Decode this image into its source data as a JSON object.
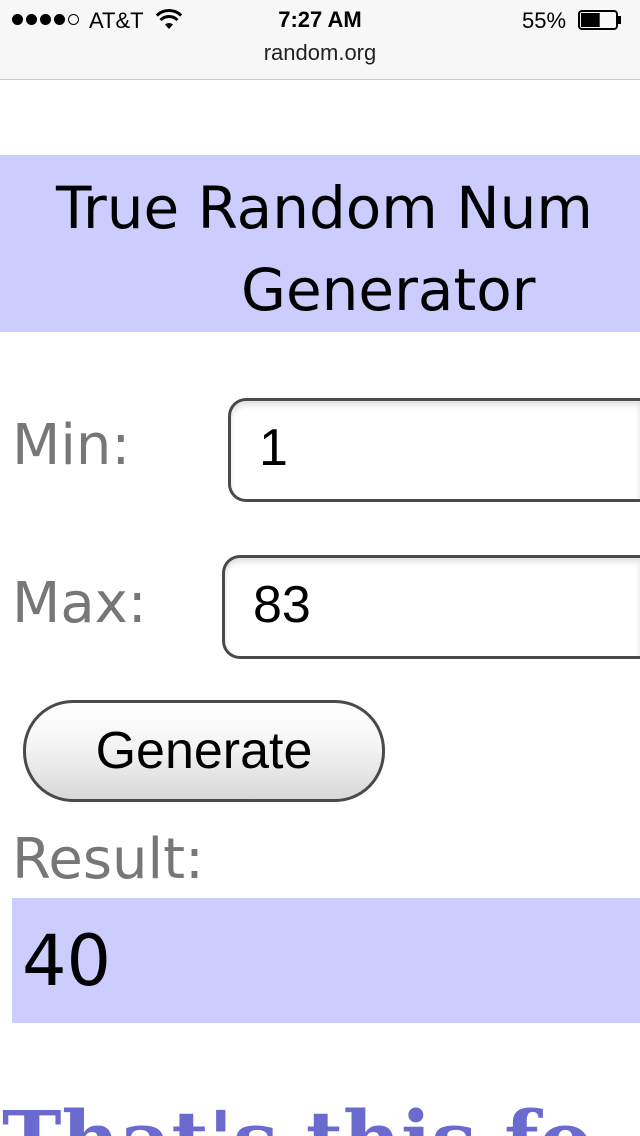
{
  "status_bar": {
    "carrier": "AT&T",
    "signal_bars": 4,
    "signal_total": 5,
    "time": "7:27 AM",
    "battery_percent": "55%",
    "battery_level": 0.55,
    "wifi_icon": "wifi-icon",
    "battery_icon": "battery-icon"
  },
  "browser": {
    "url": "random.org"
  },
  "header": {
    "title_line1": "True Random Num",
    "title_line2": "Generator",
    "background": "#ccccff"
  },
  "form": {
    "min_label": "Min:",
    "min_value": "1",
    "max_label": "Max:",
    "max_value": "83",
    "generate_label": "Generate",
    "result_label": "Result:",
    "result_value": "40"
  },
  "footer": {
    "partial_text": "That's this fo"
  },
  "colors": {
    "accent": "#ccccff",
    "label_gray": "#777777",
    "footer_link": "#6a6acf"
  }
}
